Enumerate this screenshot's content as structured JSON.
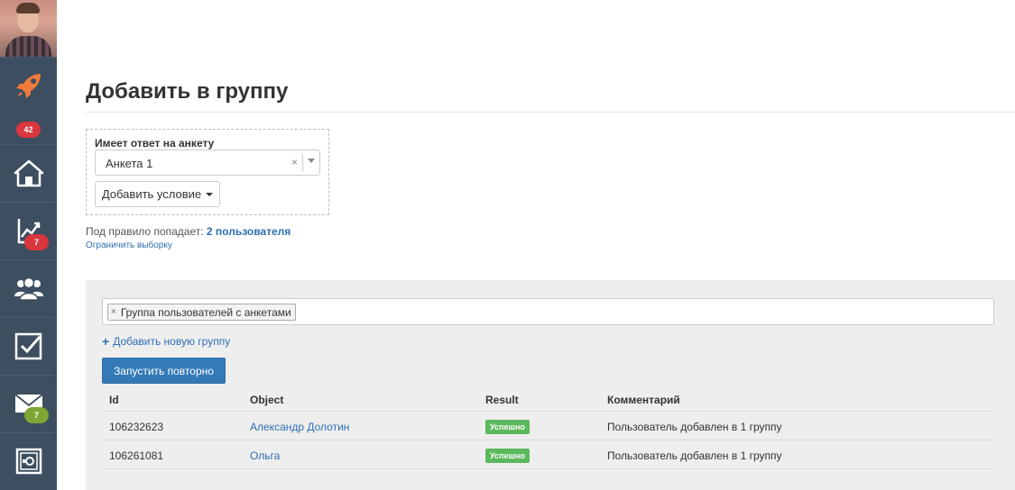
{
  "sidebar": {
    "badges": {
      "notifications": "42",
      "analytics": "7",
      "messages": "7"
    },
    "colors": {
      "background": "#3c4e5f",
      "rocket": "#f07a3a",
      "badge_red": "#d9363e",
      "badge_green": "#7fa634"
    }
  },
  "page": {
    "title": "Добавить в группу"
  },
  "rule": {
    "label": "Имеет ответ на анкету",
    "selected": "Анкета 1",
    "clear": "×",
    "add_condition": "Добавить условие",
    "summary_prefix": "Под правило попадает: ",
    "summary_count": "2 пользователя",
    "limit_link": "Ограничить выборку"
  },
  "groups": {
    "tag_remove": "×",
    "tag_label": "Группа пользователей с анкетами",
    "add_plus": "+",
    "add_new": "Добавить новую группу",
    "rerun": "Запустить повторно"
  },
  "results": {
    "headers": {
      "id": "Id",
      "object": "Object",
      "result": "Result",
      "comment": "Комментарий"
    },
    "rows": [
      {
        "id": "106232623",
        "object": "Александр Долотин",
        "result": "Успешно",
        "comment": "Пользователь добавлен в 1 группу"
      },
      {
        "id": "106261081",
        "object": "Ольга",
        "result": "Успешно",
        "comment": "Пользователь добавлен в 1 группу"
      }
    ]
  },
  "colors": {
    "accent": "#337ab7",
    "link": "#2f6fb3",
    "success": "#5cb85c",
    "panel": "#eeeeee"
  }
}
